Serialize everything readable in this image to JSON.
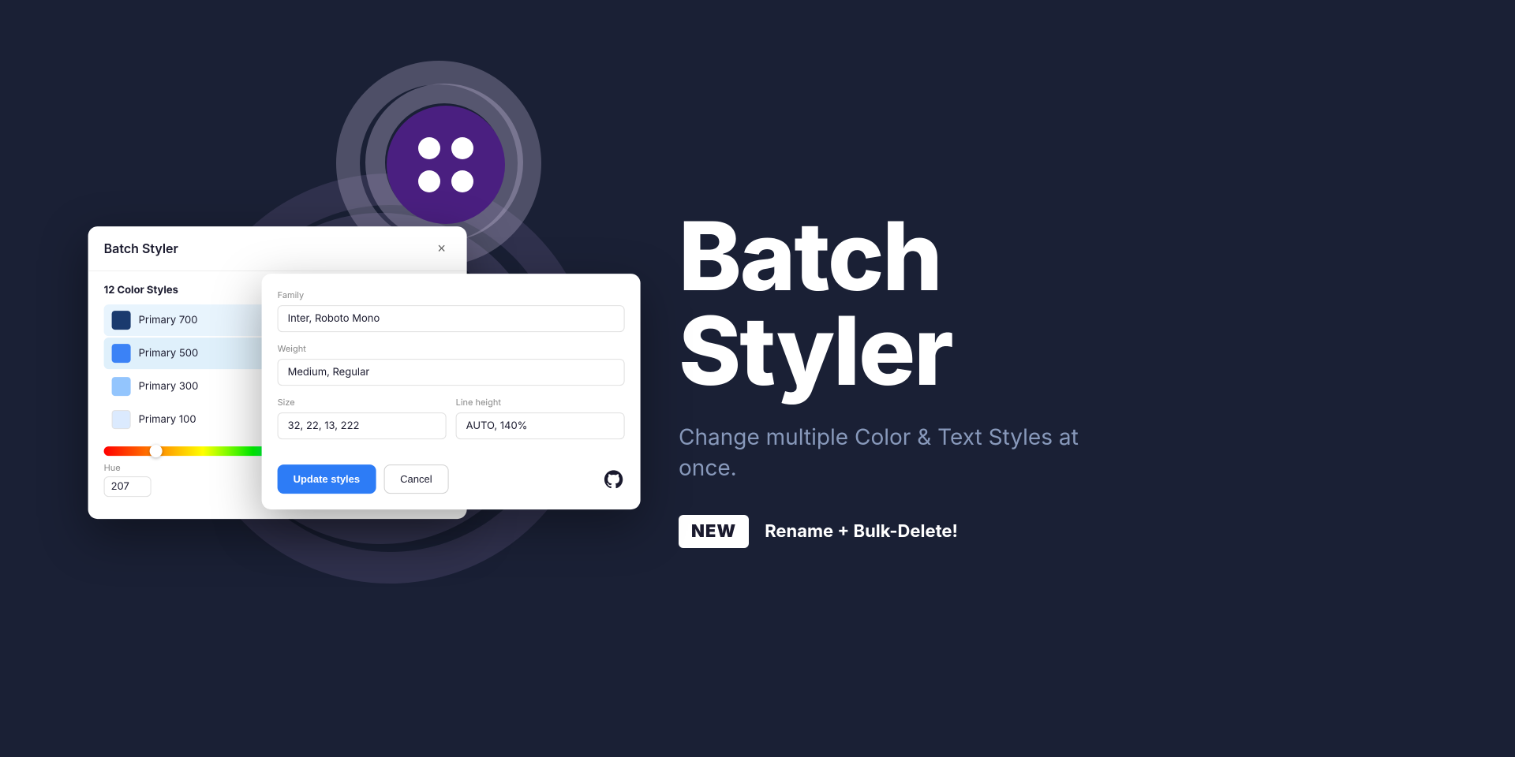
{
  "app": {
    "title": "Batch Styler",
    "background_color": "#1a2035"
  },
  "dialog": {
    "title": "Batch Styler",
    "close_label": "×",
    "section_label": "12 Color Styles",
    "color_items": [
      {
        "name": "Primary 700",
        "color": "#1a3a6e",
        "selected": true
      },
      {
        "name": "Primary 500",
        "color": "#3b82f6",
        "selected": true
      },
      {
        "name": "Primary 300",
        "color": "#93c5fd",
        "selected": false
      },
      {
        "name": "Primary 100",
        "color": "#dbeafe",
        "selected": false
      }
    ],
    "hue_label": "Hue",
    "hue_value": "207"
  },
  "text_panel": {
    "family_label": "Family",
    "family_value": "Inter, Roboto Mono",
    "weight_label": "Weight",
    "weight_value": "Medium, Regular",
    "size_label": "Size",
    "size_value": "32, 22, 13, 222",
    "line_height_label": "Line height",
    "line_height_value": "AUTO, 140%",
    "update_btn": "Update styles",
    "cancel_btn": "Cancel"
  },
  "hero": {
    "title_line1": "Batch",
    "title_line2": "Styler",
    "subtitle": "Change multiple Color & Text Styles at once.",
    "new_badge": "NEW",
    "new_feature": "Rename + Bulk-Delete!"
  },
  "decoration": {
    "figma_dots": 4
  }
}
